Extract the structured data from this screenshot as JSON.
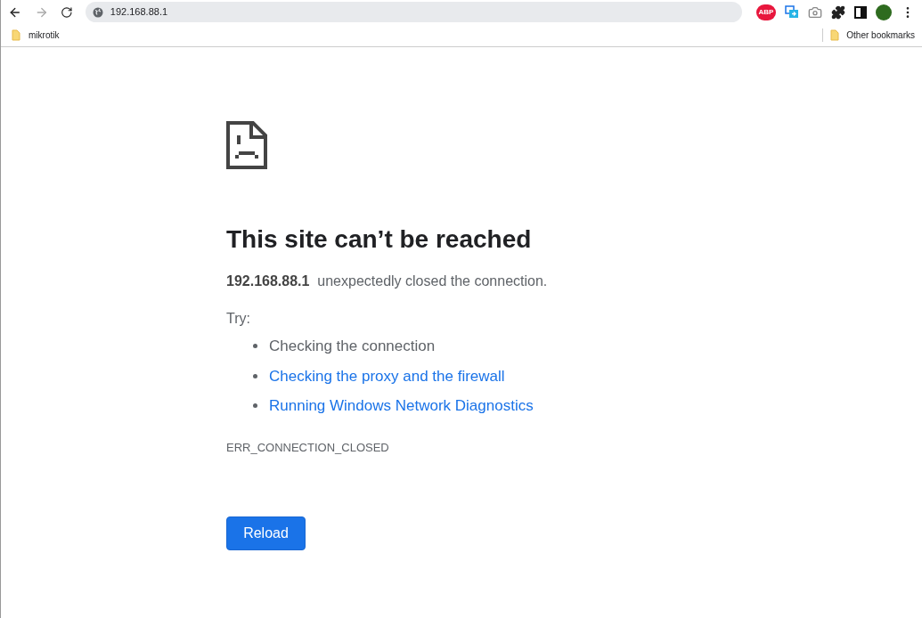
{
  "address_bar": {
    "url": "192.168.88.1"
  },
  "extensions": [
    {
      "kind": "abp",
      "label": "ABP"
    },
    {
      "kind": "cast"
    },
    {
      "kind": "camera"
    },
    {
      "kind": "puzzle"
    },
    {
      "kind": "sidepanel"
    }
  ],
  "bookmarks": [
    {
      "label": "mikrotik"
    }
  ],
  "other_bookmarks": "Other bookmarks",
  "error": {
    "title": "This site can’t be reached",
    "host": "192.168.88.1",
    "message": "unexpectedly closed the connection.",
    "try_label": "Try:",
    "suggestions": [
      {
        "text": "Checking the connection",
        "kind": "text"
      },
      {
        "text": "Checking the proxy and the firewall",
        "kind": "link"
      },
      {
        "text": "Running Windows Network Diagnostics",
        "kind": "link"
      }
    ],
    "code": "ERR_CONNECTION_CLOSED",
    "button": "Reload"
  }
}
